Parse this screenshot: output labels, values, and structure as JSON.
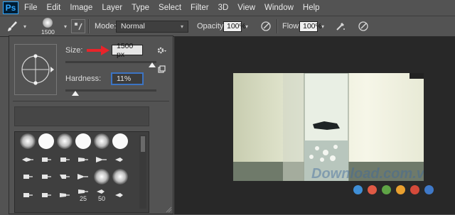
{
  "app": {
    "logo": "Ps"
  },
  "menu": [
    "File",
    "Edit",
    "Image",
    "Layer",
    "Type",
    "Select",
    "Filter",
    "3D",
    "View",
    "Window",
    "Help"
  ],
  "options": {
    "brush_size_value": "1500",
    "mode_label": "Mode:",
    "mode_value": "Normal",
    "opacity_label": "Opacity:",
    "opacity_value": "100%",
    "flow_label": "Flow:",
    "flow_value": "100%"
  },
  "brush_panel": {
    "size_label": "Size:",
    "size_value": "1500 px",
    "hardness_label": "Hardness:",
    "hardness_value": "11%",
    "size_level": 0.95,
    "hardness_level": 0.11,
    "brush_numbers": [
      "25",
      "50"
    ]
  },
  "colors": {
    "accent_arrow": "#e8242a",
    "selection_outline": "#3c74c4"
  },
  "watermark_dots": [
    "#3f8fd6",
    "#e05a45",
    "#5fa446",
    "#e9a02f",
    "#d44a3a",
    "#3f79c8"
  ]
}
